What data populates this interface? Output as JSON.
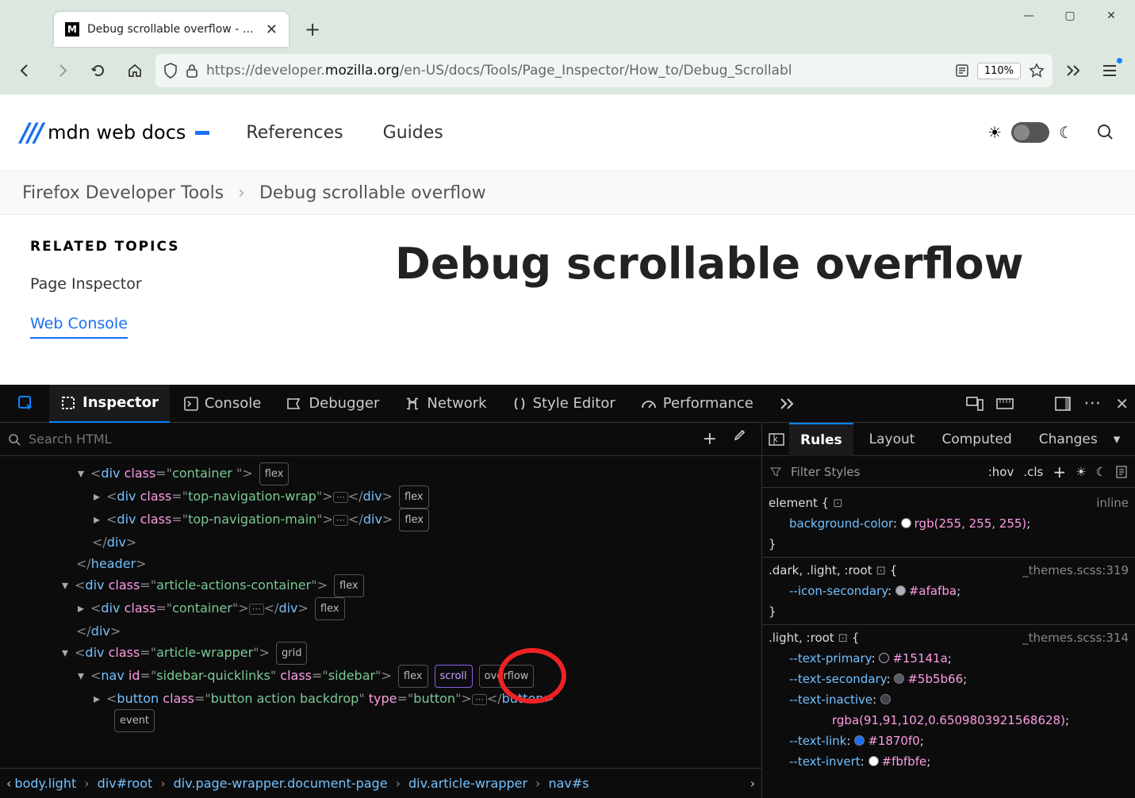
{
  "browser": {
    "tab_title": "Debug scrollable overflow - Fire",
    "url_prefix": "https://developer.",
    "url_domain": "mozilla.org",
    "url_path": "/en-US/docs/Tools/Page_Inspector/How_to/Debug_Scrollabl",
    "zoom": "110%"
  },
  "mdn": {
    "logo_text": "mdn web docs",
    "nav_references": "References",
    "nav_guides": "Guides"
  },
  "breadcrumb": {
    "a": "Firefox Developer Tools",
    "b": "Debug scrollable overflow"
  },
  "sidebar": {
    "heading": "RELATED TOPICS",
    "link1": "Page Inspector",
    "link2": "Web Console"
  },
  "page": {
    "title": "Debug scrollable overflow"
  },
  "devtools": {
    "tabs": {
      "inspector": "Inspector",
      "console": "Console",
      "debugger": "Debugger",
      "network": "Network",
      "style": "Style Editor",
      "performance": "Performance"
    },
    "search_placeholder": "Search HTML",
    "badges": {
      "flex": "flex",
      "grid": "grid",
      "scroll": "scroll",
      "overflow": "overflow",
      "event": "event"
    },
    "html": {
      "container": "container ",
      "topnavwrap": "top-navigation-wrap",
      "topnavmain": "top-navigation-main",
      "aac": "article-actions-container",
      "container2": "container",
      "aw": "article-wrapper",
      "navid": "sidebar-quicklinks",
      "navcls": "sidebar",
      "btncls": "button action backdrop",
      "btntype": "button"
    },
    "crumbs": {
      "c1": "body.light",
      "c2": "div#root",
      "c3": "div.page-wrapper.document-page",
      "c4": "div.article-wrapper",
      "c5": "nav#s"
    },
    "rules": {
      "tabs": {
        "rules": "Rules",
        "layout": "Layout",
        "computed": "Computed",
        "changes": "Changes"
      },
      "filter_placeholder": "Filter Styles",
      "hov": ":hov",
      "cls": ".cls",
      "element": "element",
      "inline": "inline",
      "bg_prop": "background-color",
      "bg_val": "rgb(255, 255, 255)",
      "sel2": ".dark, .light, :root",
      "loc2": "_themes.scss:319",
      "iconsec": "--icon-secondary",
      "iconsec_v": "#afafba",
      "sel3": ".light, :root",
      "loc3": "_themes.scss:314",
      "tp": "--text-primary",
      "tp_v": "#15141a",
      "ts": "--text-secondary",
      "ts_v": "#5b5b66",
      "ti": "--text-inactive",
      "ti_v": "rgba(91,91,102,0.6509803921568628)",
      "tl": "--text-link",
      "tl_v": "#1870f0",
      "tin": "--text-invert",
      "tin_v": "#fbfbfe"
    }
  }
}
